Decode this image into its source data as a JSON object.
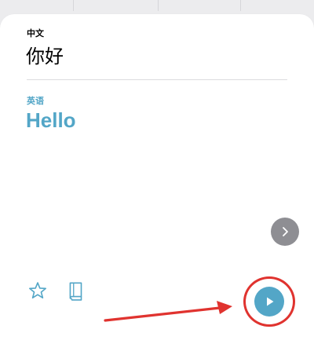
{
  "source": {
    "label": "中文",
    "text": "你好"
  },
  "target": {
    "label": "英语",
    "text": "Hello"
  },
  "icons": {
    "next": "chevron-right-icon",
    "favorite": "star-icon",
    "phrasebook": "book-icon",
    "play": "play-icon"
  },
  "colors": {
    "accent": "#53a6c7",
    "next_button": "#8e8e93",
    "annotation": "#e0332f"
  }
}
